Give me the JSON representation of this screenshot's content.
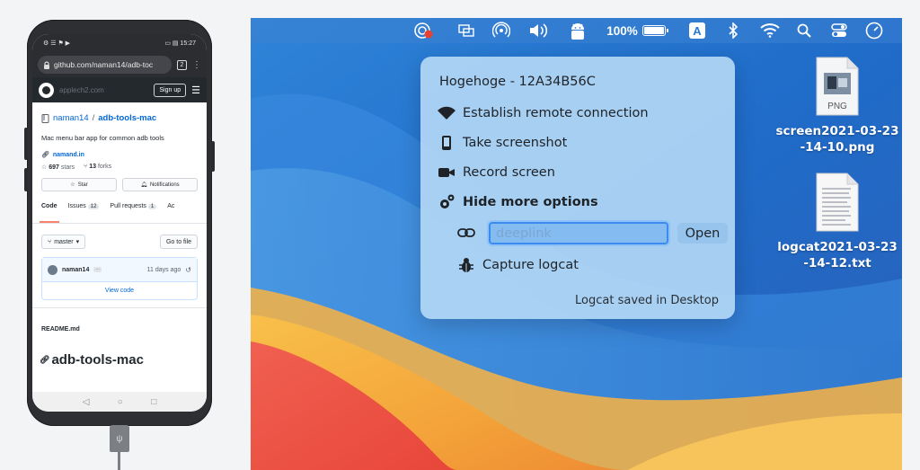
{
  "colors": {
    "github_link": "#0366d6",
    "github_dark": "#24292e",
    "dropdown_bg": "#b2d7f5",
    "input_focus": "#3b8cf0",
    "recording_dot": "#e8412f"
  },
  "phone": {
    "status_bar": {
      "left_icons": "⚙ ☰ ⚑ ▶",
      "right_text": "▭ ▤ 15:27"
    },
    "url_bar": {
      "url": "github.com/naman14/adb-toc",
      "tabs_count": "2"
    },
    "github_header": {
      "watermark": "applech2.com",
      "signup_label": "Sign up"
    },
    "repo": {
      "owner": "naman14",
      "separator": " / ",
      "name": "adb-tools-mac",
      "description": "Mac menu bar app for common adb tools",
      "website": "namand.in",
      "stars_count": "697",
      "stars_label": "stars",
      "forks_count": "13",
      "forks_label": "forks",
      "star_button": "Star",
      "notifications_button": "Notifications"
    },
    "tabs": [
      {
        "label": "Code",
        "count": ""
      },
      {
        "label": "Issues",
        "count": "12"
      },
      {
        "label": "Pull requests",
        "count": "1"
      },
      {
        "label": "Ac",
        "count": ""
      }
    ],
    "branch_label": "master",
    "go_to_file_label": "Go to file",
    "commit": {
      "author": "naman14",
      "ellipsis": "···",
      "time_ago": "11 days ago"
    },
    "view_code_label": "View code",
    "readme_label": "README.md",
    "readme_title": "adb-tools-mac"
  },
  "menubar": {
    "battery_percent": "100%",
    "battery_level": 1.0,
    "input_source": "A",
    "icons": [
      "remote-recording-icon",
      "screen-mirror-icon",
      "airdrop-icon",
      "volume-icon",
      "android-icon",
      "battery-icon",
      "input-source-icon",
      "bluetooth-icon",
      "wifi-icon",
      "spotlight-icon",
      "control-center-icon",
      "clock-icon"
    ]
  },
  "dropdown": {
    "device_title": "Hogehoge - 12A34B56C",
    "items": [
      {
        "label": "Establish remote connection",
        "icon": "wifi-icon"
      },
      {
        "label": "Take screenshot",
        "icon": "phone-icon"
      },
      {
        "label": "Record screen",
        "icon": "video-camera-icon"
      },
      {
        "label": "Hide more options",
        "icon": "gears-icon"
      }
    ],
    "deeplink_placeholder": "deeplink",
    "open_button": "Open",
    "capture_logcat_label": "Capture logcat",
    "status_text": "Logcat saved in Desktop"
  },
  "desktop_files": [
    {
      "name": "screen2021-03-23\n-14-10.png",
      "line1": "screen2021-03-23",
      "line2": "-14-10.png",
      "type_badge": "PNG"
    },
    {
      "name": "logcat2021-03-23\n-14-12.txt",
      "line1": "logcat2021-03-23",
      "line2": "-14-12.txt",
      "type_badge": ""
    }
  ]
}
